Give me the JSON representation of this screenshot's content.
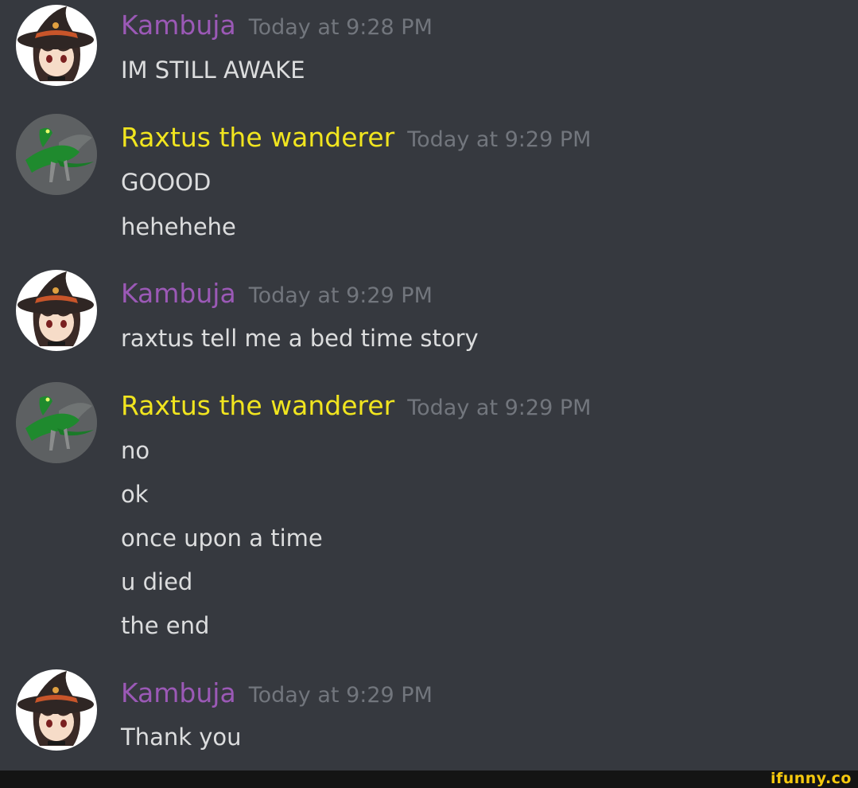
{
  "colors": {
    "background": "#36393f",
    "kambuja_name": "#9b59b6",
    "raxtus_name": "#f1e51f",
    "timestamp": "#72767d",
    "message_text": "#dcddde",
    "watermark": "#f6c90e"
  },
  "messages": [
    {
      "author": "Kambuja",
      "avatar_icon": "witch-hat-avatar-icon",
      "timestamp": "Today at 9:28 PM",
      "lines": [
        "IM STILL AWAKE"
      ]
    },
    {
      "author": "Raxtus the wanderer",
      "avatar_icon": "green-dragon-avatar-icon",
      "timestamp": "Today at 9:29 PM",
      "lines": [
        "GOOOD",
        "hehehehe"
      ]
    },
    {
      "author": "Kambuja",
      "avatar_icon": "witch-hat-avatar-icon",
      "timestamp": "Today at 9:29 PM",
      "lines": [
        "raxtus tell me a bed time story"
      ]
    },
    {
      "author": "Raxtus the wanderer",
      "avatar_icon": "green-dragon-avatar-icon",
      "timestamp": "Today at 9:29 PM",
      "lines": [
        "no",
        "ok",
        "once upon a time",
        "u died",
        "the end"
      ]
    },
    {
      "author": "Kambuja",
      "avatar_icon": "witch-hat-avatar-icon",
      "timestamp": "Today at 9:29 PM",
      "lines": [
        "Thank you"
      ]
    }
  ],
  "watermark": {
    "text": "ifunny.co"
  }
}
